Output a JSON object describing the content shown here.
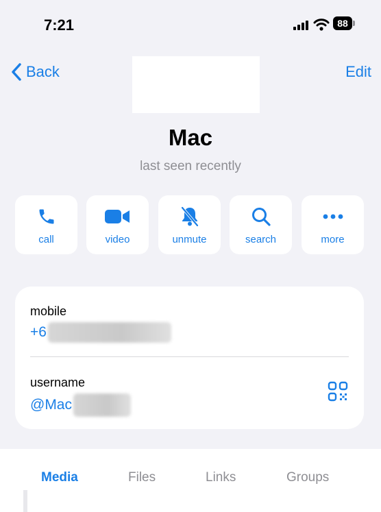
{
  "status_bar": {
    "time": "7:21",
    "battery": "88"
  },
  "nav": {
    "back_label": "Back",
    "edit_label": "Edit"
  },
  "profile": {
    "name": "Mac",
    "status": "last seen recently"
  },
  "actions": [
    {
      "label": "call",
      "icon": "phone-icon"
    },
    {
      "label": "video",
      "icon": "video-icon"
    },
    {
      "label": "unmute",
      "icon": "bell-slash-icon"
    },
    {
      "label": "search",
      "icon": "search-icon"
    },
    {
      "label": "more",
      "icon": "ellipsis-icon"
    }
  ],
  "info": {
    "mobile_label": "mobile",
    "mobile_value": "+6",
    "username_label": "username",
    "username_value": "@Mac"
  },
  "tabs": [
    {
      "label": "Media",
      "active": true
    },
    {
      "label": "Files",
      "active": false
    },
    {
      "label": "Links",
      "active": false
    },
    {
      "label": "Groups",
      "active": false
    }
  ],
  "colors": {
    "accent": "#1a7fe6",
    "background": "#f2f2f7",
    "secondary_text": "#8e8e93"
  }
}
